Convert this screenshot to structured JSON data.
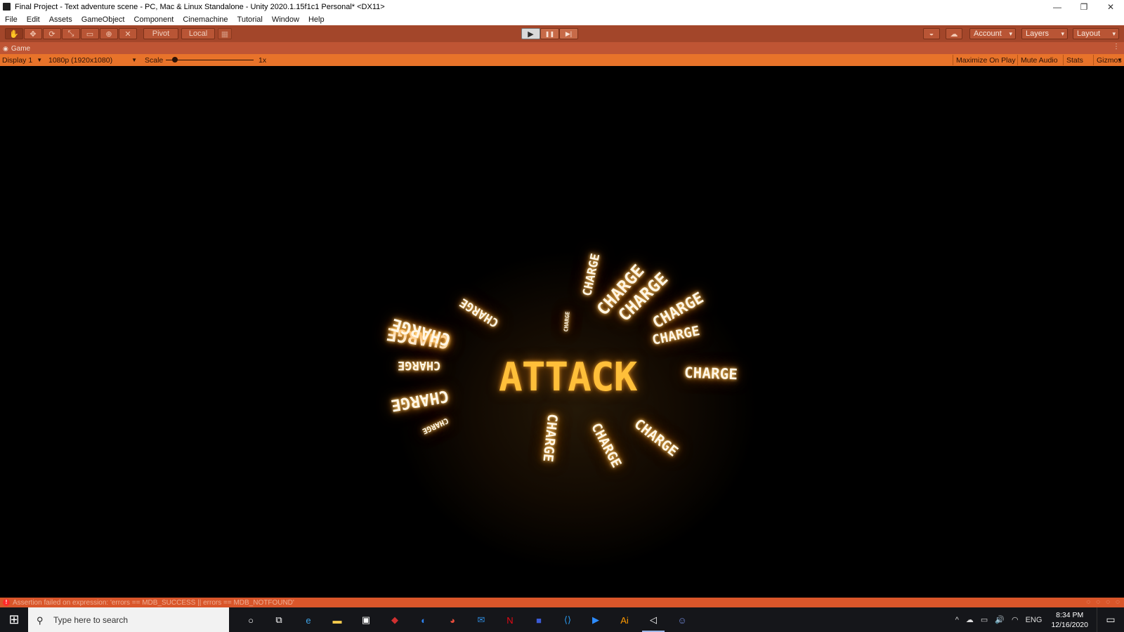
{
  "window": {
    "title": "Final Project - Text adventure scene - PC, Mac & Linux Standalone - Unity 2020.1.15f1c1 Personal* <DX11>",
    "minimize_glyph": "—",
    "restore_glyph": "❐",
    "close_glyph": "✕"
  },
  "menu": {
    "items": [
      "File",
      "Edit",
      "Assets",
      "GameObject",
      "Component",
      "Cinemachine",
      "Tutorial",
      "Window",
      "Help"
    ]
  },
  "toolbar": {
    "tools": [
      "hand-tool",
      "move-tool",
      "rotate-tool",
      "scale-tool",
      "rect-tool",
      "transform-tool",
      "custom-tool"
    ],
    "tool_glyphs": [
      "✋",
      "✥",
      "⟳",
      "⤡",
      "▭",
      "⊕",
      "✕"
    ],
    "pivot_label": "Pivot",
    "local_label": "Local",
    "grid_glyph": "▦",
    "play_glyph": "▶",
    "pause_glyph": "❚❚",
    "step_glyph": "▶|",
    "collab_glyph": "◒",
    "cloud_glyph": "☁",
    "account_label": "Account",
    "layers_label": "Layers",
    "layout_label": "Layout"
  },
  "game_tab": {
    "icon": "gamepad-icon",
    "icon_glyph": "◉",
    "label": "Game",
    "more_glyph": "⋮"
  },
  "game_controls": {
    "display_label": "Display 1",
    "resolution_label": "1080p (1920x1080)",
    "scale_label": "Scale",
    "scale_value": "1x",
    "scale_fraction": 0.1,
    "maximize_on_play": "Maximize On Play",
    "mute_audio": "Mute Audio",
    "stats": "Stats",
    "gizmos": "Gizmos"
  },
  "scene": {
    "center_word": "ATTACK",
    "word": "CHARGE",
    "colors": {
      "center": "#ffbf3a",
      "glow": "#ffa028",
      "word": "#fff6e6"
    }
  },
  "status": {
    "error_glyph": "!",
    "message": "Assertion failed on expression: 'errors == MDB_SUCCESS || errors == MDB_NOTFOUND'"
  },
  "taskbar": {
    "search_placeholder": "Type here to search",
    "search_glyph": "⚲",
    "start_glyph": "⊞",
    "apps": [
      {
        "name": "cortana-icon",
        "glyph": "○",
        "color": "#ffffff"
      },
      {
        "name": "task-view-icon",
        "glyph": "⧉",
        "color": "#ffffff"
      },
      {
        "name": "edge-icon",
        "glyph": "e",
        "color": "#3fa4e8"
      },
      {
        "name": "file-explorer-icon",
        "glyph": "▬",
        "color": "#f2c94c"
      },
      {
        "name": "store-icon",
        "glyph": "▣",
        "color": "#ffffff"
      },
      {
        "name": "game-icon",
        "glyph": "◆",
        "color": "#d03030"
      },
      {
        "name": "browser-icon",
        "glyph": "◐",
        "color": "#2e82ef"
      },
      {
        "name": "chrome-icon",
        "glyph": "◕",
        "color": "#e84d3c"
      },
      {
        "name": "mail-icon",
        "glyph": "✉",
        "color": "#2f8bde"
      },
      {
        "name": "netflix-icon",
        "glyph": "N",
        "color": "#e50914"
      },
      {
        "name": "app-icon",
        "glyph": "■",
        "color": "#3b5bd6"
      },
      {
        "name": "vscode-icon",
        "glyph": "⟨⟩",
        "color": "#2a9df4"
      },
      {
        "name": "zoom-icon",
        "glyph": "▶",
        "color": "#2d8cff"
      },
      {
        "name": "illustrator-icon",
        "glyph": "Ai",
        "color": "#ff9a00"
      },
      {
        "name": "unity-icon",
        "glyph": "◁",
        "color": "#ffffff"
      },
      {
        "name": "discord-icon",
        "glyph": "☺",
        "color": "#7289da"
      }
    ],
    "tray_symbols": [
      "^",
      "☁",
      "▭",
      "🔊",
      "◠"
    ],
    "language": "ENG",
    "time": "8:34 PM",
    "date": "12/16/2020",
    "notification_glyph": "▭"
  }
}
